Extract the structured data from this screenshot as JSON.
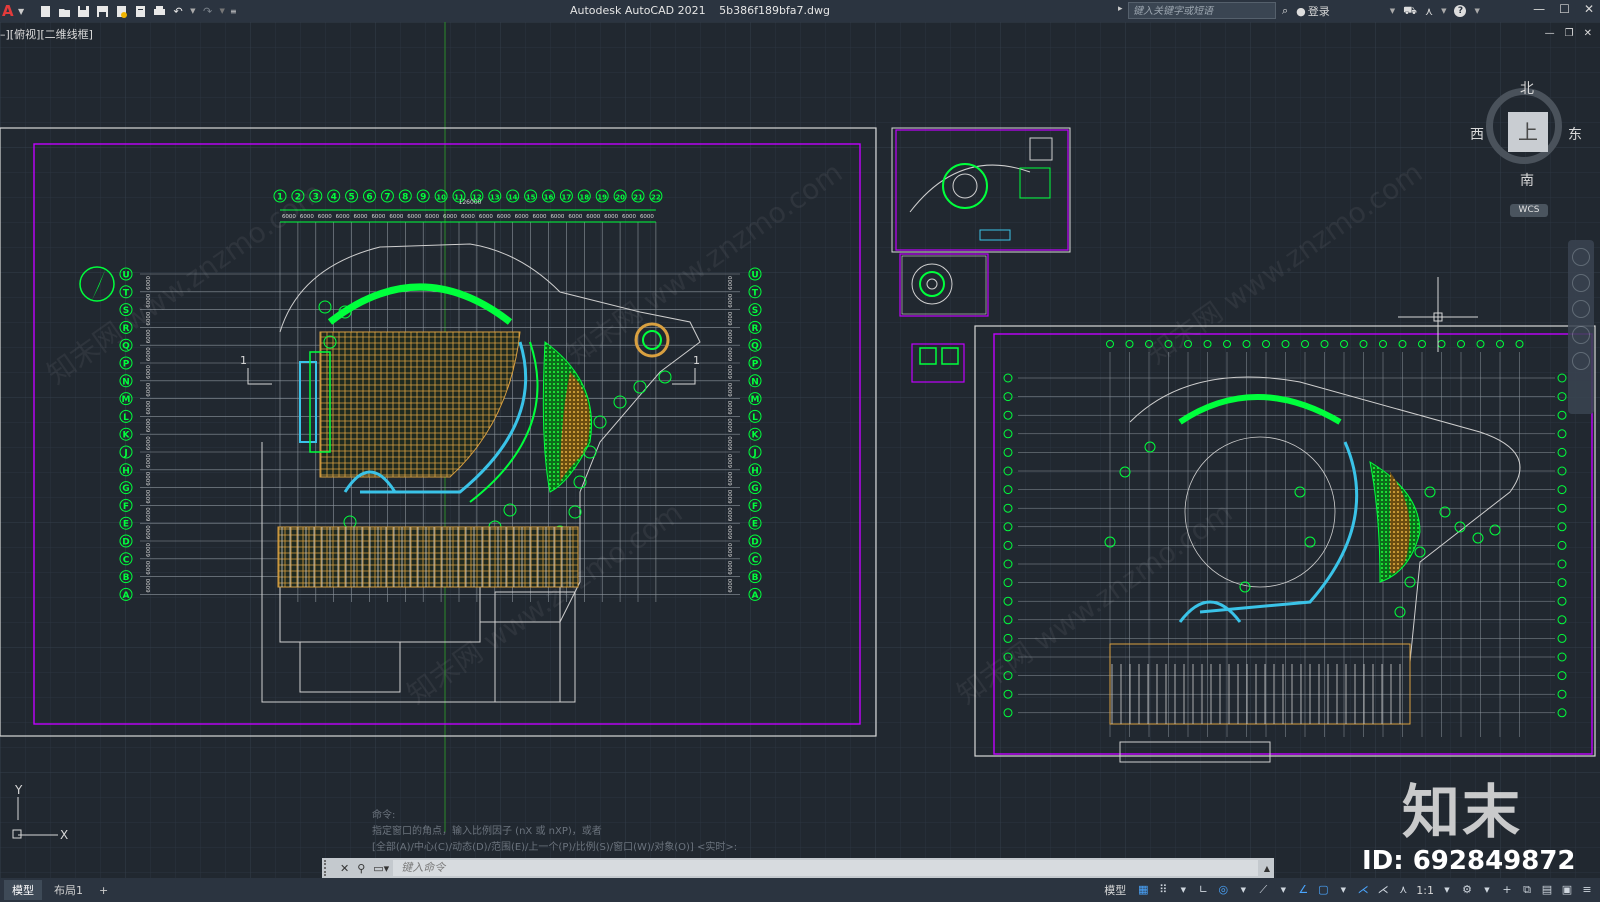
{
  "app": {
    "title": "Autodesk AutoCAD 2021",
    "filename": "5b386f189bfa7.dwg",
    "logo": "A"
  },
  "search": {
    "placeholder": "键入关键字或短语"
  },
  "account": {
    "login": "登录"
  },
  "viewport": {
    "label": "–][俯视][二维线框]"
  },
  "viewcube": {
    "north": "北",
    "south": "南",
    "west": "西",
    "east": "东",
    "top": "上",
    "wcs": "WCS"
  },
  "command": {
    "history": [
      "命令:",
      "指定窗口的角点，输入比例因子 (nX 或 nXP)，或者",
      "[全部(A)/中心(C)/动态(D)/范围(E)/上一个(P)/比例(S)/窗口(W)/对象(O)] <实时>:"
    ],
    "placeholder": "键入命令"
  },
  "tabs": [
    {
      "label": "模型",
      "active": true
    },
    {
      "label": "布局1",
      "active": false
    }
  ],
  "status": {
    "model": "模型",
    "scale": "1:1"
  },
  "watermark": {
    "brand": "知末",
    "id": "ID: 692849872",
    "site": "知末网 www.znzmo.com"
  },
  "drawing": {
    "grid_letters": [
      "U",
      "T",
      "S",
      "R",
      "Q",
      "P",
      "N",
      "M",
      "L",
      "K",
      "J",
      "H",
      "G",
      "F",
      "E",
      "D",
      "C",
      "B",
      "A"
    ],
    "grid_numbers": [
      "1",
      "2",
      "3",
      "4",
      "5",
      "6",
      "7",
      "8",
      "9",
      "10",
      "11",
      "12",
      "13",
      "14",
      "15",
      "16",
      "17",
      "18",
      "19",
      "20",
      "21",
      "22"
    ],
    "dim_value": "6000",
    "total_dim": "126000"
  },
  "colors": {
    "bg": "#212830",
    "green": "#00ff3c",
    "magenta": "#c000ff",
    "white": "#d8d8d8",
    "orange": "#d9a040"
  }
}
